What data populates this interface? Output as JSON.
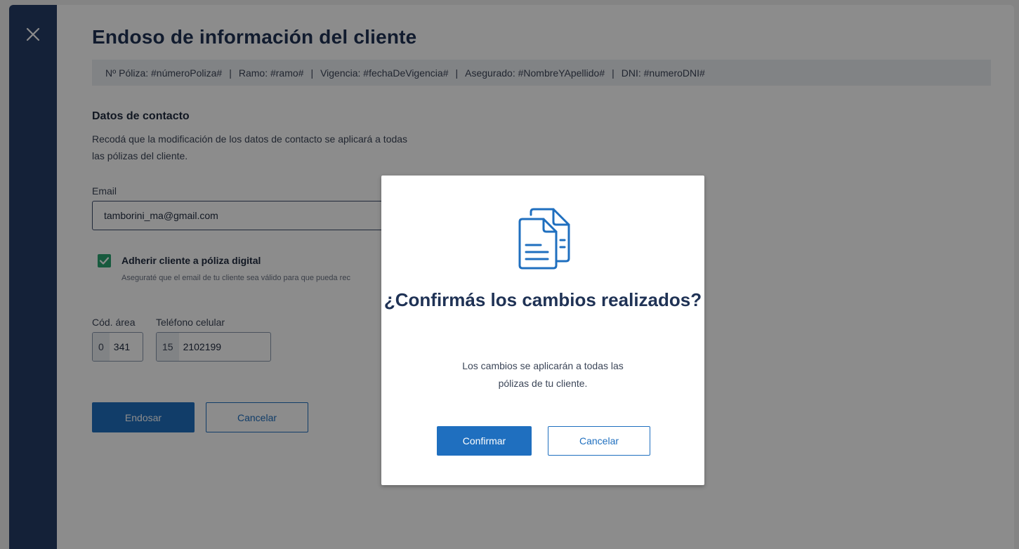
{
  "page": {
    "title": "Endoso de información del cliente",
    "info_bar": {
      "poliza": "Nº Póliza: #númeroPoliza#",
      "ramo": "Ramo: #ramo#",
      "vigencia": "Vigencia: #fechaDeVigencia#",
      "asegurado": "Asegurado: #NombreYApellido#",
      "dni": "DNI: #numeroDNI#",
      "separator": "|"
    },
    "contact": {
      "title": "Datos de contacto",
      "description": "Recodá que la modificación de los datos de contacto se aplicará a todas las pólizas del cliente.",
      "email_label": "Email",
      "email_value": "tamborini_ma@gmail.com",
      "checkbox_checked": true,
      "checkbox_label": "Adherir cliente a póliza digital",
      "checkbox_description": "Aseguraté que el email de tu cliente sea válido para que pueda rec",
      "area_label": "Cód. área",
      "area_prefix": "0",
      "area_value": "341",
      "phone_label": "Teléfono celular",
      "phone_prefix": "15",
      "phone_value": "2102199"
    },
    "buttons": {
      "endosar": "Endosar",
      "cancelar": "Cancelar"
    }
  },
  "modal": {
    "icon": "documents-icon",
    "title": "¿Confirmás los cambios realizados?",
    "body": "Los cambios se aplicarán a todas las pólizas de tu cliente.",
    "confirm": "Confirmar",
    "cancel": "Cancelar"
  },
  "colors": {
    "sidebar": "#253c66",
    "primary": "#1f6fbf",
    "title": "#1f3255",
    "checkbox": "#2aa471"
  }
}
